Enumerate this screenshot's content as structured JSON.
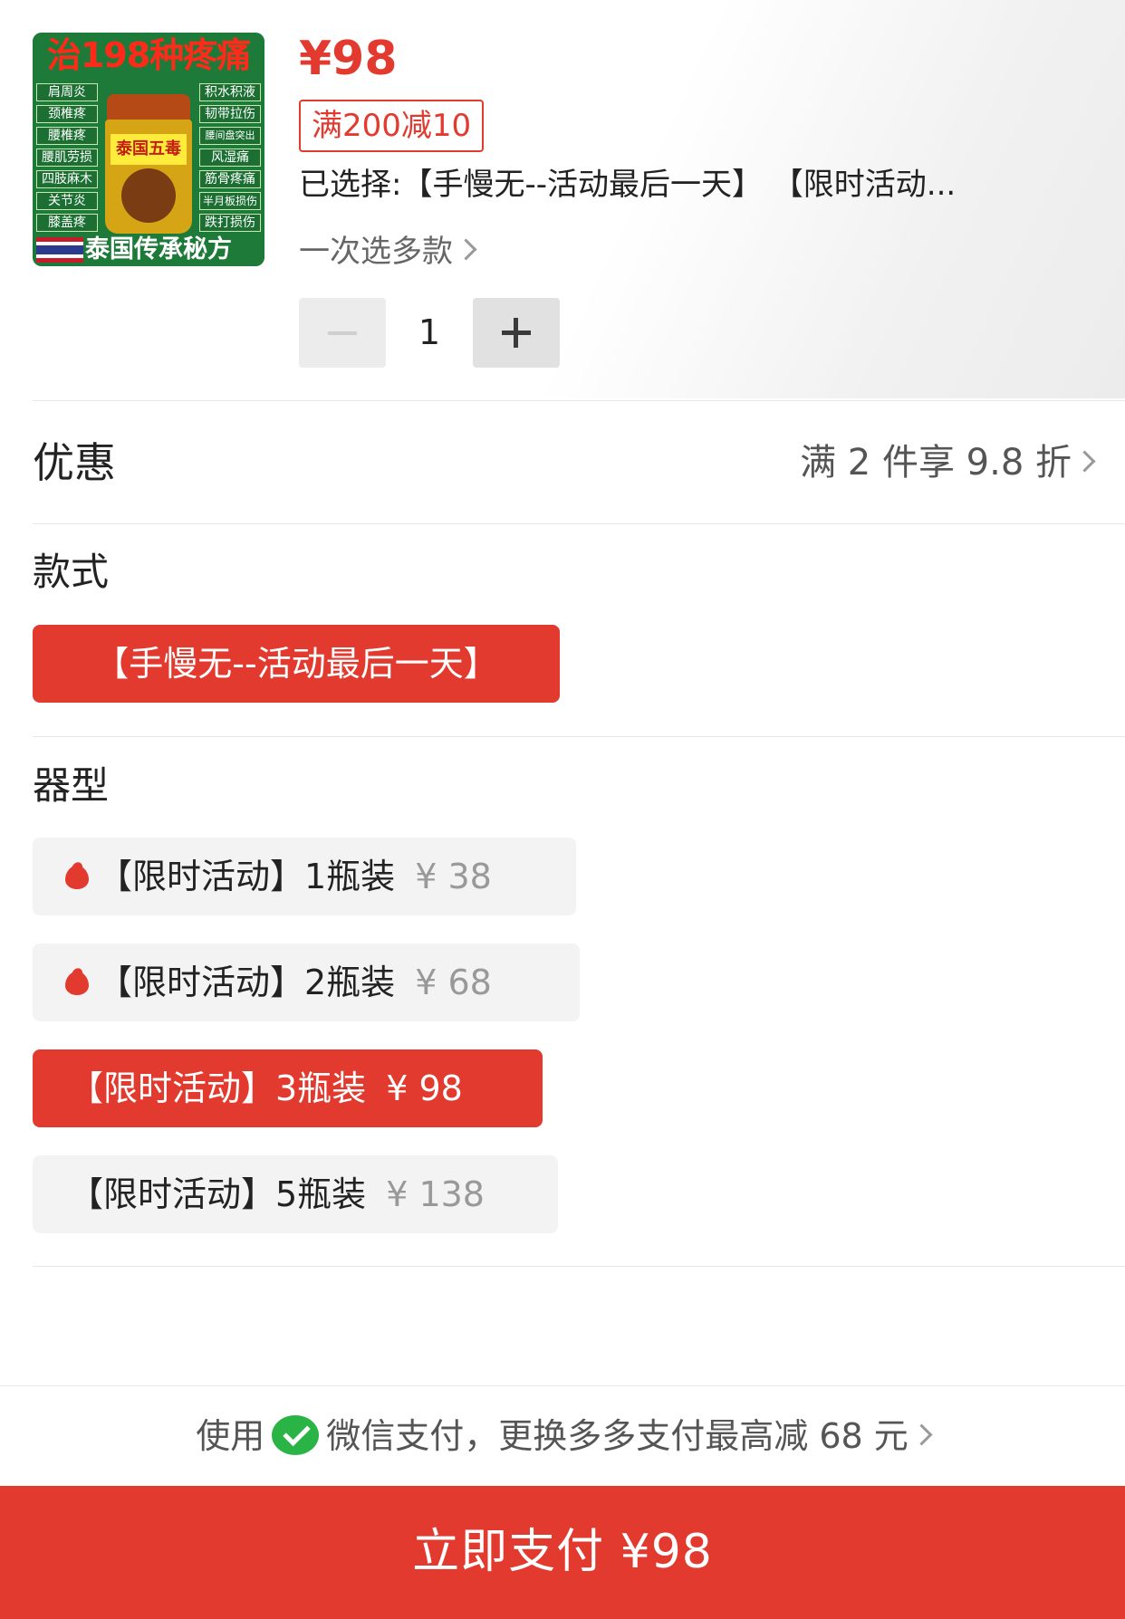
{
  "product": {
    "image_text": {
      "top": "治198种疼痛",
      "left_items": [
        "肩周炎",
        "颈椎疼",
        "腰椎疼",
        "腰肌劳损",
        "四肢麻木",
        "关节炎",
        "膝盖疼"
      ],
      "right_items": [
        "积水积液",
        "韧带拉伤",
        "腰间盘突出",
        "风湿痛",
        "筋骨疼痛",
        "半月板损伤",
        "跌打损伤"
      ],
      "jar_label": "泰国五毒",
      "bottom": "泰国传承秘方"
    },
    "price": "¥98",
    "coupon": "满200减10",
    "selected": "已选择:【手慢无--活动最后一天】 【限时活动...",
    "multi_select": "一次选多款",
    "quantity": "1"
  },
  "discount": {
    "label": "优惠",
    "value": "满 2 件享 9.8 折"
  },
  "style_section": {
    "title": "款式",
    "options": [
      {
        "label": "【手慢无--活动最后一天】",
        "selected": true
      }
    ]
  },
  "type_section": {
    "title": "器型",
    "options": [
      {
        "label": "【限时活动】1瓶装",
        "price": "¥ 38",
        "hot": true,
        "selected": false
      },
      {
        "label": "【限时活动】2瓶装",
        "price": "¥ 68",
        "hot": true,
        "selected": false
      },
      {
        "label": "【限时活动】3瓶装",
        "price": "¥ 98",
        "hot": false,
        "selected": true
      },
      {
        "label": "【限时活动】5瓶装",
        "price": "¥ 138",
        "hot": false,
        "selected": false
      }
    ]
  },
  "payment": {
    "hint_prefix": "使用",
    "hint_suffix": "微信支付，更换多多支付最高减 68 元",
    "button": "立即支付 ¥98"
  },
  "colors": {
    "accent": "#e23a2e",
    "wechat": "#2bb446"
  }
}
